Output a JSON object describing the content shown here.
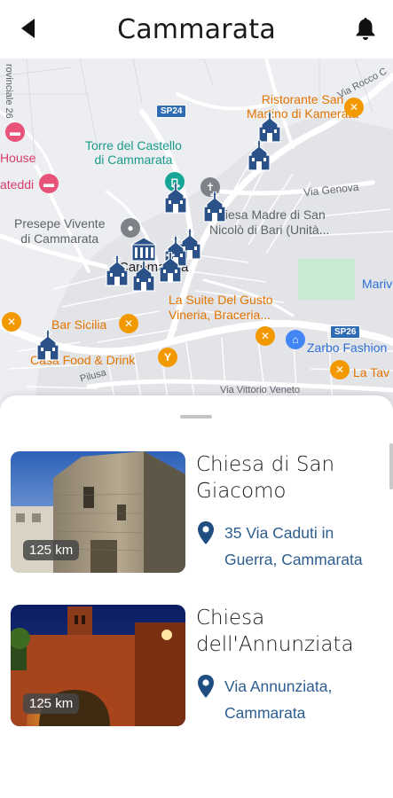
{
  "header": {
    "title": "Cammarata"
  },
  "map": {
    "labels": {
      "ristorante": "Ristorante San\nMartino di Kamerata",
      "torre": "Torre del Castello\ndi Cammarata",
      "chiesa_madre": "Chiesa Madre di San\nNicolò di Bari (Unità...",
      "presepe": "Presepe Vivente\ndi Cammarata",
      "cammarata": "Cammarata",
      "suite": "La Suite Del Gusto\nVineria, Braceria...",
      "bar_sicilia": "Bar Sicilia",
      "casa_food": "Casa Food & Drink",
      "zarbo": "Zarbo Fashion",
      "la_tav": "La Tav",
      "mari": "Mariv",
      "house": "House",
      "teddi": "ateddi",
      "via_genova": "Via Genova",
      "via_vittorio": "Via Vittorio Veneto",
      "via_rocco": "Via Rocco C",
      "provinciale": "rovinciale 26",
      "pilusa": "Pilusa",
      "sp24": "SP24",
      "sp26": "SP26"
    }
  },
  "places": [
    {
      "name": "Chiesa di San Giacomo",
      "address": "35 Via Caduti in Guerra, Cammarata",
      "distance": "125 km"
    },
    {
      "name": "Chiesa dell'Annunziata",
      "address": "Via Annunziata, Cammarata",
      "distance": "125 km"
    }
  ]
}
